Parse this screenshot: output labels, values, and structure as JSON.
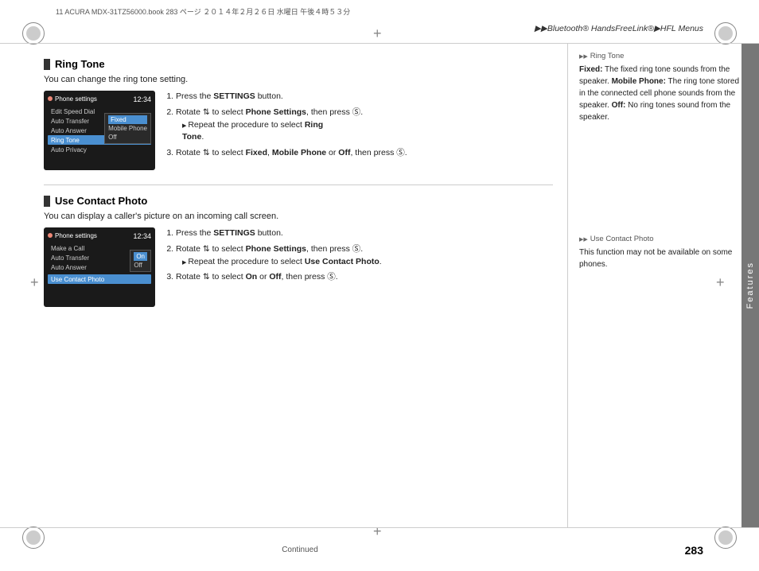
{
  "header": {
    "file_info": "11 ACURA MDX-31TZ56000.book  283 ページ  ２０１４年２月２６日  水曜日  午後４時５３分",
    "nav": "▶▶Bluetooth® HandsFreeLink®▶HFL Menus"
  },
  "footer": {
    "continued": "Continued",
    "page_number": "283"
  },
  "sections": [
    {
      "id": "ring-tone",
      "title": "Ring Tone",
      "description": "You can change the ring tone setting.",
      "screen1": {
        "label": "Phone settings",
        "time": "12:34",
        "menu_items": [
          "Edit Speed Dial",
          "Auto Transfer",
          "Auto Answer",
          "Ring Tone",
          "Auto Privacy"
        ],
        "ring_options": [
          "Fixed",
          "Mobile Phone",
          "Off"
        ]
      },
      "steps": [
        "Press the <b>SETTINGS</b> button.",
        "Rotate <span>&#x21BB;</span> to select <b>Phone Settings</b>, then press <span>&#x2609;</span>.",
        "&#x25BA; Repeat the procedure to select <b>Ring Tone</b>.",
        "Rotate <span>&#x21BB;</span> to select <b>Fixed</b>, <b>Mobile Phone</b> or <b>Off</b>, then press <span>&#x2609;</span>."
      ],
      "note_header": "Ring Tone",
      "note_text": "<b>Fixed:</b> The fixed ring tone sounds from the speaker. <b>Mobile Phone:</b> The ring tone stored in the connected cell phone sounds from the speaker. <b>Off:</b> No ring tones sound from the speaker."
    },
    {
      "id": "use-contact-photo",
      "title": "Use Contact Photo",
      "description": "You can display a caller's picture on an incoming call screen.",
      "screen2": {
        "label": "Phone settings",
        "time": "12:34",
        "menu_items": [
          "Make a Call",
          "Auto Transfer",
          "Auto Answer",
          "",
          "Use Contact Photo"
        ],
        "contact_options": [
          "On",
          "Off"
        ]
      },
      "steps": [
        "Press the <b>SETTINGS</b> button.",
        "Rotate <span>&#x21BB;</span> to select <b>Phone Settings</b>, then press <span>&#x2609;</span>.",
        "&#x25BA; Repeat the procedure to select <b>Use Contact Photo</b>.",
        "Rotate <span>&#x21BB;</span> to select <b>On</b> or <b>Off</b>, then press <span>&#x2609;</span>."
      ],
      "note_header": "Use Contact Photo",
      "note_text": "This function may not be available on some phones."
    }
  ],
  "features_label": "Features",
  "icons": {
    "section_block": "■",
    "arrow": "▶",
    "double_arrow": "▶▶"
  }
}
